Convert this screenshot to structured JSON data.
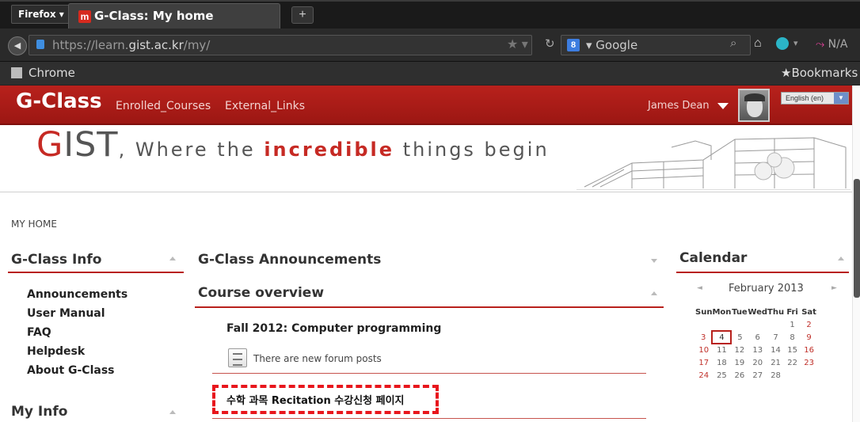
{
  "browser": {
    "firefox_button": "Firefox ▾",
    "tab_title": "G-Class: My home",
    "new_tab": "+",
    "url_gray_prefix": "https://learn.",
    "url_domain": "gist.ac.kr",
    "url_suffix": "/my/",
    "search_engine": "▾ Google",
    "addon_text": "N/A",
    "bookmarks_left": "Chrome",
    "bookmarks_right": "Bookmarks"
  },
  "site": {
    "brand": "G-Class",
    "nav": [
      "Enrolled_Courses",
      "External_Links"
    ],
    "user_name": "James Dean",
    "language": "English (en)",
    "slogan": {
      "g": "G",
      "ist": "IST",
      "comma": ",",
      "where": " Where the ",
      "incredible": "incredible",
      "rest": " things begin"
    },
    "breadcrumb": "MY HOME"
  },
  "left": {
    "info_title": "G-Class Info",
    "links": [
      "Announcements",
      "User Manual",
      "FAQ",
      "Helpdesk",
      "About G-Class"
    ],
    "myinfo_title": "My Info"
  },
  "center": {
    "announcements_title": "G-Class Announcements",
    "overview_title": "Course overview",
    "course_title": "Fall 2012: Computer programming",
    "forum_text": "There are new forum posts",
    "recitation": "수학 과목 Recitation 수강신청 페이지"
  },
  "calendar": {
    "title": "Calendar",
    "month": "February 2013",
    "prev": "◄",
    "next": "►",
    "days": [
      "Sun",
      "Mon",
      "Tue",
      "Wed",
      "Thu",
      "Fri",
      "Sat"
    ],
    "weeks": [
      [
        "",
        "",
        "",
        "",
        "",
        "1",
        "2"
      ],
      [
        "3",
        "4",
        "5",
        "6",
        "7",
        "8",
        "9"
      ],
      [
        "10",
        "11",
        "12",
        "13",
        "14",
        "15",
        "16"
      ],
      [
        "17",
        "18",
        "19",
        "20",
        "21",
        "22",
        "23"
      ],
      [
        "24",
        "25",
        "26",
        "27",
        "28",
        "",
        ""
      ]
    ],
    "today": "4"
  },
  "colors": {
    "brand_red": "#b8211c",
    "highlight_red": "#e8161c"
  }
}
